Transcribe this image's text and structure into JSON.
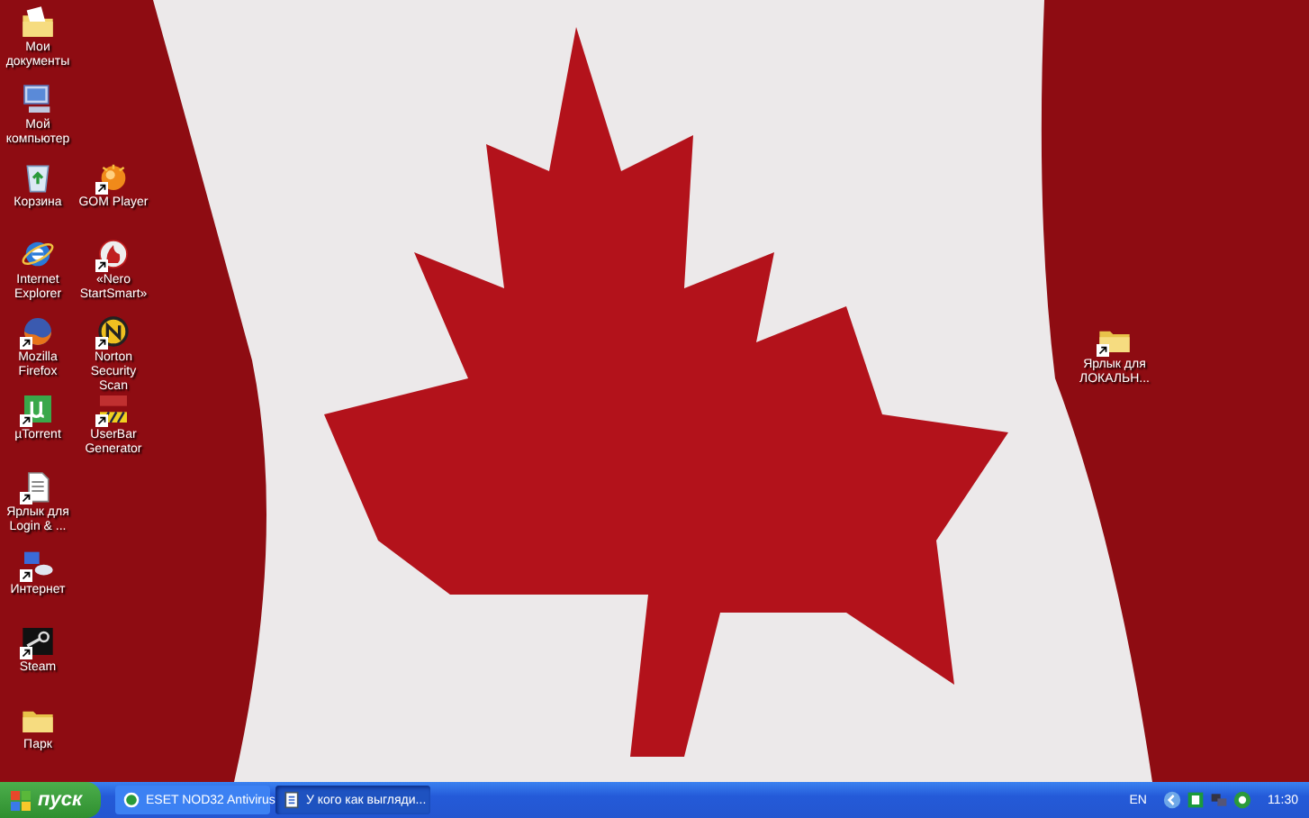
{
  "desktop": {
    "left_column": [
      {
        "label": "Мои документы",
        "kind": "documents",
        "shortcut": false
      },
      {
        "label": "Мой компьютер",
        "kind": "computer",
        "shortcut": false
      },
      {
        "label": "Корзина",
        "kind": "recycle",
        "shortcut": false
      },
      {
        "label": "Internet Explorer",
        "kind": "browser-e",
        "shortcut": false
      },
      {
        "label": "Mozilla Firefox",
        "kind": "fox",
        "shortcut": true
      },
      {
        "label": "µTorrent",
        "kind": "mu",
        "shortcut": true
      },
      {
        "label": "Ярлык для Login & ...",
        "kind": "file",
        "shortcut": true
      },
      {
        "label": "Интернет",
        "kind": "network",
        "shortcut": true
      },
      {
        "label": "Steam",
        "kind": "steam",
        "shortcut": true
      },
      {
        "label": "Парк",
        "kind": "folder",
        "shortcut": false
      }
    ],
    "second_column": [
      {
        "label": "GOM Player",
        "kind": "gom",
        "shortcut": true
      },
      {
        "label": "«Nero StartSmart»",
        "kind": "nero",
        "shortcut": true
      },
      {
        "label": "Norton Security Scan",
        "kind": "norton",
        "shortcut": true
      },
      {
        "label": "UserBar Generator",
        "kind": "userbar",
        "shortcut": true
      }
    ],
    "right_icons": [
      {
        "label": "Ярлык для ЛОКАЛЬН...",
        "kind": "folder",
        "shortcut": true
      }
    ]
  },
  "taskbar": {
    "start_label": "пуск",
    "tasks": [
      {
        "label": "ESET NOD32 Antivirus",
        "kind": "eset",
        "selected": false
      },
      {
        "label": "У кого как выгляди...",
        "kind": "doc",
        "selected": true
      }
    ],
    "language": "EN",
    "clock": "11:30"
  }
}
